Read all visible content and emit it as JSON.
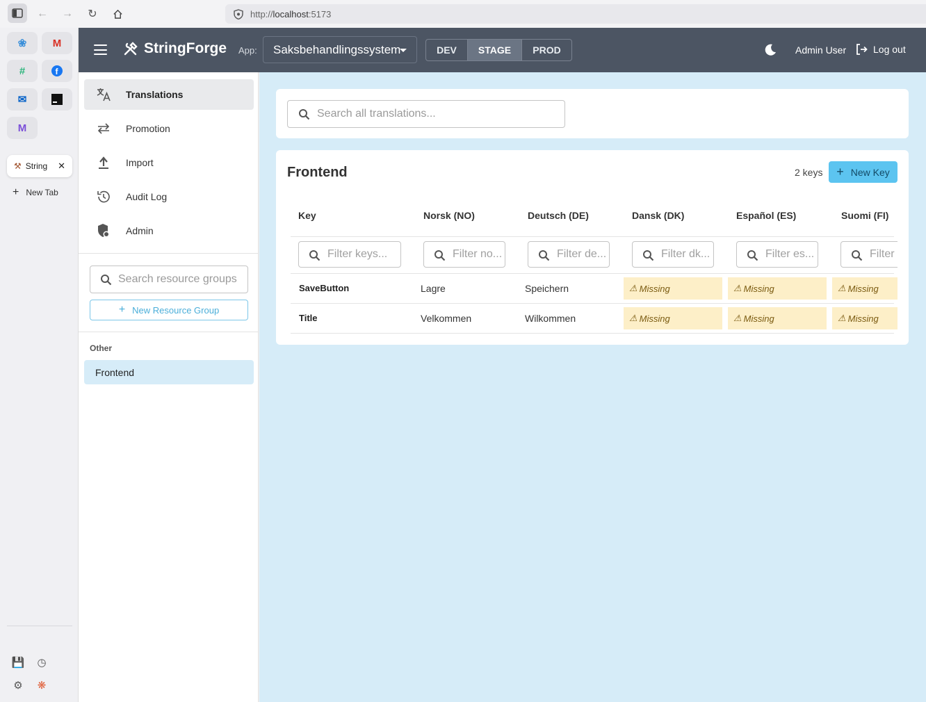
{
  "browser": {
    "url_prefix": "http://",
    "url_host": "localhost",
    "url_port": ":5173",
    "tab_title": "String",
    "new_tab_label": "New Tab"
  },
  "header": {
    "brand": "StringForge",
    "app_label": "App:",
    "app_selected": "Saksbehandlingssystem",
    "environments": [
      "DEV",
      "STAGE",
      "PROD"
    ],
    "active_environment": "STAGE",
    "user": "Admin User",
    "logout": "Log out"
  },
  "sidebar": {
    "items": [
      {
        "label": "Translations",
        "icon": "translate-icon"
      },
      {
        "label": "Promotion",
        "icon": "swap-icon"
      },
      {
        "label": "Import",
        "icon": "upload-icon"
      },
      {
        "label": "Audit Log",
        "icon": "history-icon"
      },
      {
        "label": "Admin",
        "icon": "admin-shield-icon"
      }
    ],
    "search_placeholder": "Search resource groups",
    "new_group_label": "New Resource Group",
    "group_heading": "Other",
    "groups": [
      "Frontend"
    ]
  },
  "main": {
    "search_placeholder": "Search all translations...",
    "group_title": "Frontend",
    "key_count": "2 keys",
    "new_key_label": "New Key",
    "columns": [
      "Key",
      "Norsk (NO)",
      "Deutsch (DE)",
      "Dansk (DK)",
      "Español (ES)",
      "Suomi (FI)"
    ],
    "filter_placeholders": [
      "Filter keys...",
      "Filter no...",
      "Filter de...",
      "Filter dk...",
      "Filter es...",
      "Filter fi..."
    ],
    "missing_label": "Missing",
    "rows": [
      {
        "key": "SaveButton",
        "no": "Lagre",
        "de": "Speichern"
      },
      {
        "key": "Title",
        "no": "Velkommen",
        "de": "Wilkommen"
      }
    ]
  }
}
